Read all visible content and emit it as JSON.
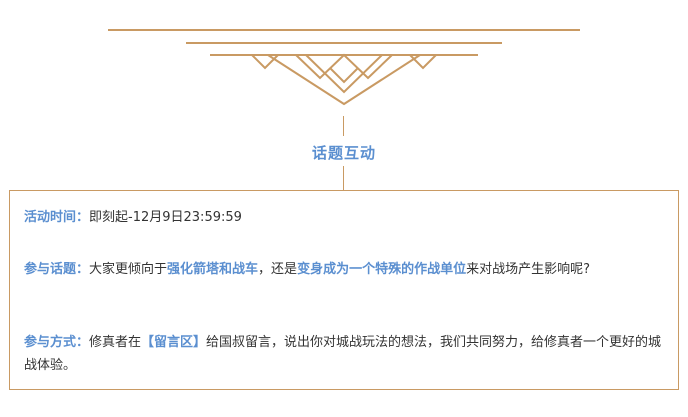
{
  "section": {
    "title": "话题互动"
  },
  "activity_time": {
    "label": "活动时间：",
    "value": "即刻起-12月9日23:59:59"
  },
  "topic": {
    "label": "参与话题：",
    "text_before": "大家更倾向于",
    "highlight_1": "强化箭塔和战车",
    "text_middle": "，还是",
    "highlight_2": "变身成为一个特殊的作战单位",
    "text_after": "来对战场产生影响呢?"
  },
  "method": {
    "label": "参与方式：",
    "text_before": "修真者在",
    "highlight": "【留言区】",
    "text_after": "给国叔留言，说出你对城战玩法的想法，我们共同努力，给修真者一个更好的城战体验。"
  },
  "colors": {
    "accent_blue": "#5b8fd0",
    "ornament_gold": "#c99a63",
    "body_text": "#333333"
  }
}
